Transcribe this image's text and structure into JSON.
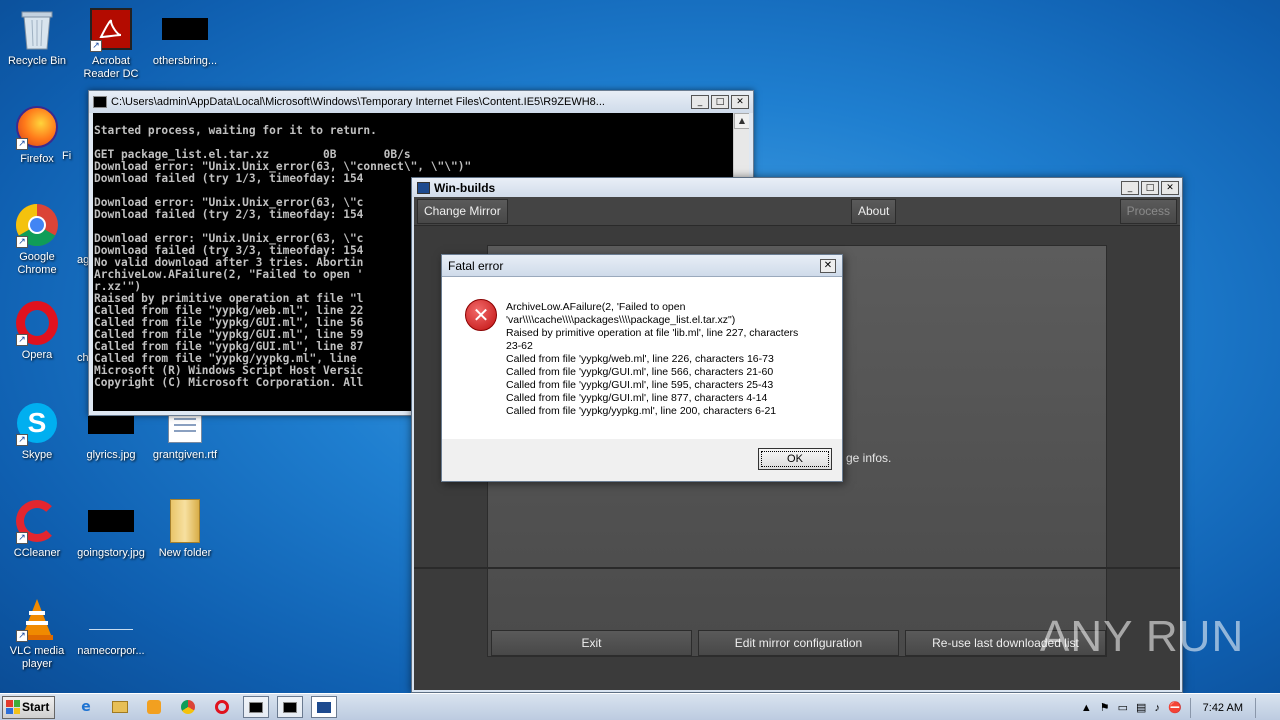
{
  "desktop": {
    "icons": [
      {
        "label": "Recycle Bin",
        "icon": "recycle-bin-icon"
      },
      {
        "label": "Acrobat Reader DC",
        "icon": "acrobat-icon"
      },
      {
        "label": "othersbring...",
        "icon": "image-file-icon"
      },
      {
        "label": "Firefox",
        "icon": "firefox-icon"
      },
      {
        "label": "Google Chrome",
        "icon": "chrome-icon"
      },
      {
        "label": "Opera",
        "icon": "opera-icon"
      },
      {
        "label": "Skype",
        "icon": "skype-icon"
      },
      {
        "label": "glyrics.jpg",
        "icon": "image-file-icon"
      },
      {
        "label": "grantgiven.rtf",
        "icon": "document-icon"
      },
      {
        "label": "CCleaner",
        "icon": "ccleaner-icon"
      },
      {
        "label": "goingstory.jpg",
        "icon": "image-file-icon"
      },
      {
        "label": "New folder",
        "icon": "folder-icon"
      },
      {
        "label": "VLC media player",
        "icon": "vlc-icon"
      },
      {
        "label": "namecorpor...",
        "icon": "image-file-icon"
      }
    ],
    "partial_labels": [
      "Fi",
      "ag",
      "ch"
    ]
  },
  "console": {
    "title": "C:\\Users\\admin\\AppData\\Local\\Microsoft\\Windows\\Temporary Internet Files\\Content.IE5\\R9ZEWH8...",
    "lines": [
      "Started process, waiting for it to return.",
      "",
      "GET package_list.el.tar.xz        0B       0B/s",
      "Download error: \"Unix.Unix_error(63, \\\"connect\\\", \\\"\\\")\"",
      "Download failed (try 1/3, timeofday: 154",
      "",
      "Download error: \"Unix.Unix_error(63, \\\"c",
      "Download failed (try 2/3, timeofday: 154",
      "",
      "Download error: \"Unix.Unix_error(63, \\\"c",
      "Download failed (try 3/3, timeofday: 154",
      "No valid download after 3 tries. Abortin",
      "ArchiveLow.AFailure(2, \"Failed to open '",
      "r.xz'\")",
      "Raised by primitive operation at file \"l",
      "Called from file \"yypkg/web.ml\", line 22",
      "Called from file \"yypkg/GUI.ml\", line 56",
      "Called from file \"yypkg/GUI.ml\", line 59",
      "Called from file \"yypkg/GUI.ml\", line 87",
      "Called from file \"yypkg/yypkg.ml\", line ",
      "Microsoft (R) Windows Script Host Versic",
      "Copyright (C) Microsoft Corporation. All"
    ]
  },
  "winbuilds": {
    "title": "Win-builds",
    "change_mirror": "Change Mirror",
    "about": "About",
    "process": "Process",
    "hint": "ge infos.",
    "exit": "Exit",
    "edit_mirror": "Edit mirror configuration",
    "reuse_list": "Re-use last downloaded list"
  },
  "dialog": {
    "title": "Fatal error",
    "message": [
      "ArchiveLow.AFailure(2, 'Failed to open",
      "'var\\\\\\\\cache\\\\\\\\packages\\\\\\\\package_list.el.tar.xz\")",
      "Raised by primitive operation at file 'lib.ml', line 227, characters",
      "23-62",
      "Called from file 'yypkg/web.ml', line 226, characters 16-73",
      "Called from file 'yypkg/GUI.ml', line 566, characters 21-60",
      "Called from file 'yypkg/GUI.ml', line 595, characters 25-43",
      "Called from file 'yypkg/GUI.ml', line 877, characters 4-14",
      "Called from file 'yypkg/yypkg.ml', line 200, characters 6-21"
    ],
    "ok": "OK"
  },
  "taskbar": {
    "start": "Start",
    "clock": "7:42 AM"
  },
  "watermark": "ANY RUN"
}
